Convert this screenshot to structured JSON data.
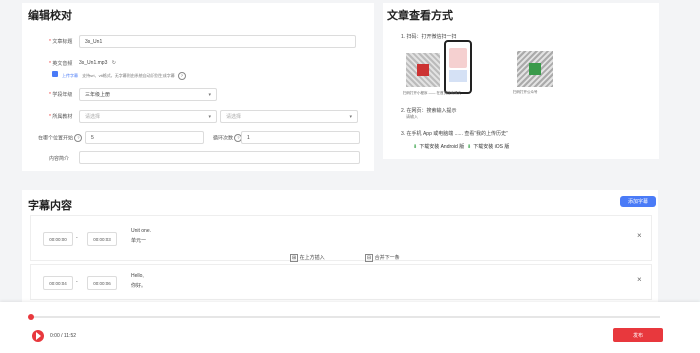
{
  "edit_section": {
    "title": "编辑校对",
    "fields": {
      "title_label": "文章标题",
      "title_value": "3s_Un1",
      "audio_label": "英文音频",
      "audio_value": "3s_Un1.mp3",
      "reupload_label": "上传字幕",
      "reupload_hint": "支持srt、vtt格式，无字幕则由系统自动识别生成字幕",
      "level_label": "学段年级",
      "level_value": "三年级上册",
      "textbook_label": "所属教材",
      "textbook_placeholder": "请选择",
      "unit_placeholder": "请选择",
      "start_label": "在哪个位置开始",
      "start_value": "5",
      "loop_label": "循环次数",
      "loop_value": "1",
      "intro_label": "内容简介"
    }
  },
  "view_section": {
    "title": "文章查看方式",
    "step1": "1. 扫码：打开微信扫一扫",
    "qr_caption_left": "扫码打开小程序 —— 在首页搜索课文",
    "qr_caption_right": "扫码打开公众号",
    "step2_line1": "2. 在网页：搜索输入提示",
    "step2_line2": "请输入",
    "step3": "3. 在手机 App 或电脑端 ...... 查看“我的上传历史”",
    "download_android": "下载安装 Android 版",
    "download_ios": "下载安装 iOS 版"
  },
  "subtitle_section": {
    "title": "字幕内容",
    "add_button": "添加字幕",
    "rows": [
      {
        "start": "00:00:00",
        "end": "00:00:03",
        "en": "Unit one.",
        "cn": "单元一"
      },
      {
        "start": "00:00:04",
        "end": "00:00:06",
        "en": "Hello,",
        "cn": "你好。"
      }
    ],
    "insert_above": "在上方插入",
    "merge_below": "合并下一条"
  },
  "player": {
    "time": "0:00 / 11:52",
    "publish_button": "发布",
    "progress_fraction": 0.0
  },
  "colors": {
    "accent_red": "#e8383d",
    "accent_blue": "#4a7bf7"
  }
}
